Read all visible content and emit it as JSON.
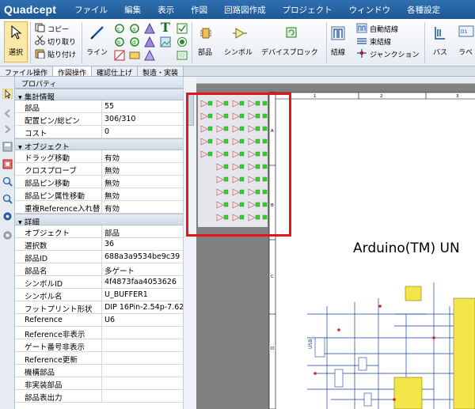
{
  "app": {
    "logo": "Quadcept"
  },
  "menu": [
    "ファイル",
    "編集",
    "表示",
    "作図",
    "回路図作成",
    "プロジェクト",
    "ウィンドウ",
    "各種設定"
  ],
  "ribbon": {
    "select": "選択",
    "copy": "コピー",
    "cut": "切り取り",
    "paste": "貼り付け",
    "line": "ライン",
    "text_icon": "T",
    "part": "部品",
    "symbol": "シンボル",
    "device_block": "デバイスブロック",
    "wire": "結線",
    "auto_wire": "自動結線",
    "bundle_wire": "束結線",
    "junction": "ジャンクション",
    "bus": "バス",
    "label": "ラベ"
  },
  "tabs": [
    "ファイル操作",
    "作図操作",
    "確認仕上げ",
    "製造・実装"
  ],
  "panel": {
    "title": "プロパティ",
    "sections": {
      "summary": "集計情報",
      "object": "オブジェクト",
      "detail": "詳細"
    },
    "summary_rows": [
      {
        "key": "部品",
        "value": "55"
      },
      {
        "key": "配置ピン/総ピン",
        "value": "306/310"
      },
      {
        "key": "コスト",
        "value": "0"
      }
    ],
    "object_rows": [
      {
        "key": "ドラッグ移動",
        "value": "有効"
      },
      {
        "key": "クロスプローブ",
        "value": "無効"
      },
      {
        "key": "部品ピン移動",
        "value": "無効"
      },
      {
        "key": "部品ピン属性移動",
        "value": "無効"
      },
      {
        "key": "重複Reference入れ替え",
        "value": "有効"
      }
    ],
    "detail_rows": [
      {
        "key": "オブジェクト",
        "value": "部品"
      },
      {
        "key": "選択数",
        "value": "36"
      },
      {
        "key": "部品ID",
        "value": "688a3a9534be9c39"
      },
      {
        "key": "部品名",
        "value": "多ゲート"
      },
      {
        "key": "シンボルID",
        "value": "4f4873faa4053626"
      },
      {
        "key": "シンボル名",
        "value": "U_BUFFER1"
      },
      {
        "key": "フットプリント形状",
        "value": "DIP 16Pin-2.54p-7.62"
      },
      {
        "key": "Reference",
        "value": "U6"
      },
      {
        "key": "Reference非表示",
        "value": ""
      },
      {
        "key": "ゲート番号非表示",
        "value": ""
      },
      {
        "key": "Reference更新",
        "value": ""
      },
      {
        "key": "機構部品",
        "value": ""
      },
      {
        "key": "非実装部品",
        "value": ""
      },
      {
        "key": "部品表出力",
        "value": ""
      }
    ]
  },
  "canvas": {
    "sheet_title": "Arduino(TM) UN",
    "ruler_numbers": [
      "1",
      "2",
      "3"
    ],
    "row_letters": [
      "A",
      "B",
      "C",
      "D"
    ],
    "usb_label": "USB"
  }
}
